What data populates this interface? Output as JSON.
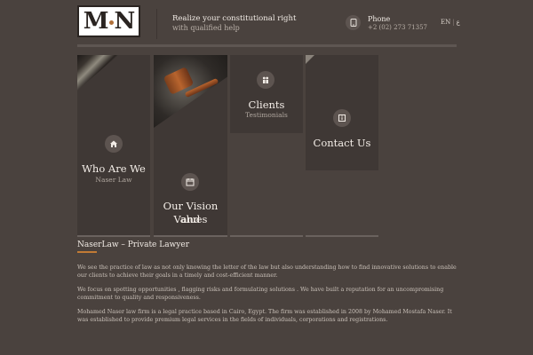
{
  "header": {
    "logo_text_left": "M",
    "logo_text_right": "N",
    "tagline_line1": "Realize your constitutional right",
    "tagline_line2": "with qualified help",
    "phone_label": "Phone",
    "phone_number": "+2 (02) 273 71357",
    "lang_en": "EN",
    "lang_ar": "ع"
  },
  "tiles": [
    {
      "title": "Who Are We",
      "subtitle": "Naser Law",
      "icon": "home-icon"
    },
    {
      "title_line1": "Our Vision and",
      "title_line2": "Values",
      "icon": "calendar-icon"
    },
    {
      "title": "Clients",
      "subtitle": "Testimonials",
      "icon": "users-icon"
    },
    {
      "title": "Contact Us",
      "icon": "info-icon"
    }
  ],
  "content": {
    "title": "NaserLaw – Private Lawyer",
    "paragraphs": [
      "We see the practice of law as not only knowing the letter of the law but also understanding how to find innovative solutions to enable our clients to achieve their goals in a timely and cost-efficient manner.",
      "We focus on spotting opportunities , flagging risks and formulating  solutions . We have built a reputation for an uncompromising commitment to quality and responsiveness.",
      "Mohamed Naser law firm is a legal practice based in Cairo, Egypt. The firm was established in 2008 by Mohamed Mostafa Naser. It was established to provide premium legal services in the fields of individuals, corporations and registrations."
    ]
  }
}
